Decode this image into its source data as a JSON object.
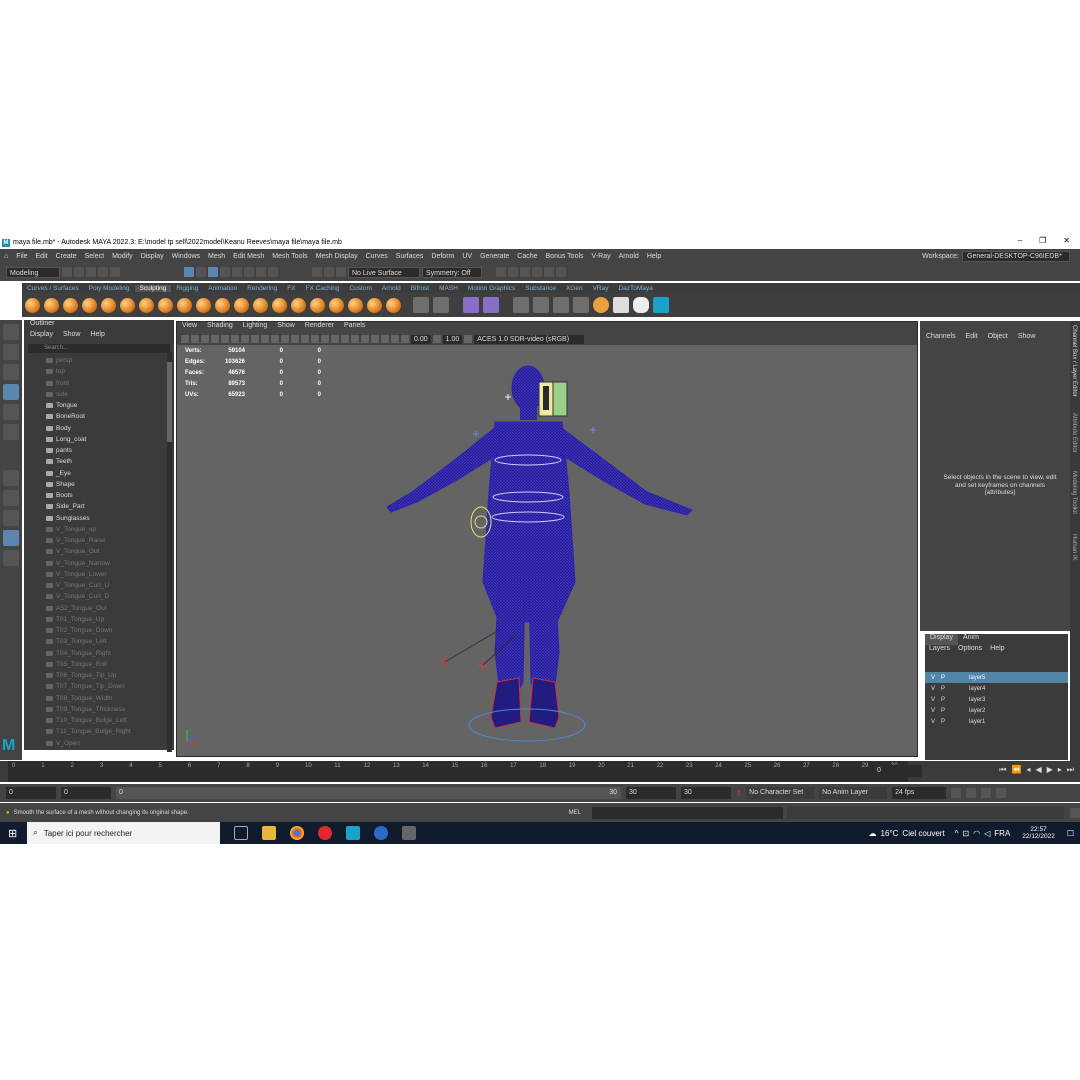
{
  "window": {
    "title": "maya file.mb* - Autodesk MAYA 2022.3: E:\\model tp sell\\2022model\\Keanu Reeves\\maya file\\maya file.mb"
  },
  "menubar": {
    "items": [
      "File",
      "Edit",
      "Create",
      "Select",
      "Modify",
      "Display",
      "Windows",
      "Mesh",
      "Edit Mesh",
      "Mesh Tools",
      "Mesh Display",
      "Curves",
      "Surfaces",
      "Deform",
      "UV",
      "Generate",
      "Cache",
      "Bonus Tools",
      "V-Ray",
      "Arnold",
      "Help"
    ],
    "workspace_label": "Workspace:",
    "workspace_value": "General-DESKTOP-C96IEDB*"
  },
  "statusline": {
    "mode": "Modeling",
    "live_surface": "No Live Surface",
    "symmetry": "Symmetry: Off"
  },
  "shelf": {
    "tabs": [
      "Curves / Surfaces",
      "Poly Modeling",
      "Sculpting",
      "Rigging",
      "Animation",
      "Rendering",
      "FX",
      "FX Caching",
      "Custom",
      "Arnold",
      "Bifrost",
      "MASH",
      "Motion Graphics",
      "Substance",
      "XGen",
      "VRay",
      "DazToMaya"
    ],
    "active_tab": "Sculpting"
  },
  "outliner": {
    "title": "Outliner",
    "menu": [
      "Display",
      "Show",
      "Help"
    ],
    "search_placeholder": "Search...",
    "items": [
      {
        "label": "persp",
        "dim": true
      },
      {
        "label": "top",
        "dim": true
      },
      {
        "label": "front",
        "dim": true
      },
      {
        "label": "side",
        "dim": true
      },
      {
        "label": "Tongue",
        "dim": false
      },
      {
        "label": "BoneRoot",
        "dim": false
      },
      {
        "label": "Body",
        "dim": false
      },
      {
        "label": "Long_coat",
        "dim": false
      },
      {
        "label": "pants",
        "dim": false
      },
      {
        "label": "Teeth",
        "dim": false
      },
      {
        "label": "_Eye",
        "dim": false
      },
      {
        "label": "Shape",
        "dim": false
      },
      {
        "label": "Boots",
        "dim": false
      },
      {
        "label": "Side_Part",
        "dim": false
      },
      {
        "label": "Sunglasses",
        "dim": false
      },
      {
        "label": "V_Tongue_up",
        "dim": true
      },
      {
        "label": "V_Tongue_Raise",
        "dim": true
      },
      {
        "label": "V_Tongue_Out",
        "dim": true
      },
      {
        "label": "V_Tongue_Narrow",
        "dim": true
      },
      {
        "label": "V_Tongue_Lower",
        "dim": true
      },
      {
        "label": "V_Tongue_Curl_U",
        "dim": true
      },
      {
        "label": "V_Tongue_Curl_D",
        "dim": true
      },
      {
        "label": "A52_Tongue_Out",
        "dim": true
      },
      {
        "label": "T01_Tongue_Up",
        "dim": true
      },
      {
        "label": "T02_Tongue_Down",
        "dim": true
      },
      {
        "label": "T03_Tongue_Left",
        "dim": true
      },
      {
        "label": "T04_Tongue_Right",
        "dim": true
      },
      {
        "label": "T05_Tongue_Roll",
        "dim": true
      },
      {
        "label": "T06_Tongue_Tip_Up",
        "dim": true
      },
      {
        "label": "T07_Tongue_Tip_Down",
        "dim": true
      },
      {
        "label": "T08_Tongue_Width",
        "dim": true
      },
      {
        "label": "T09_Tongue_Thickness",
        "dim": true
      },
      {
        "label": "T10_Tongue_Bulge_Left",
        "dim": true
      },
      {
        "label": "T11_Tongue_Bulge_Right",
        "dim": true
      },
      {
        "label": "V_Open",
        "dim": true
      }
    ]
  },
  "viewport": {
    "menu": [
      "View",
      "Shading",
      "Lighting",
      "Show",
      "Renderer",
      "Panels"
    ],
    "exposure": "0.00",
    "gamma": "1.00",
    "colorspace": "ACES 1.0 SDR-video (sRGB)",
    "hud": [
      {
        "label": "Verts:",
        "value": "59104",
        "a": "0",
        "b": "0"
      },
      {
        "label": "Edges:",
        "value": "103626",
        "a": "0",
        "b": "0"
      },
      {
        "label": "Faces:",
        "value": "46576",
        "a": "0",
        "b": "0"
      },
      {
        "label": "Tris:",
        "value": "89573",
        "a": "0",
        "b": "0"
      },
      {
        "label": "UVs:",
        "value": "65923",
        "a": "0",
        "b": "0"
      }
    ]
  },
  "channelbox": {
    "menu": [
      "Channels",
      "Edit",
      "Object",
      "Show"
    ],
    "message": "Select objects in the scene to view, edit and set keyframes on channels (attributes)",
    "side_tabs": [
      "Channel Box / Layer Editor",
      "Attribute Editor",
      "Modeling Toolkit",
      "Human IK"
    ]
  },
  "layers": {
    "tabs": [
      "Display",
      "Anim"
    ],
    "menu": [
      "Layers",
      "Options",
      "Help"
    ],
    "rows": [
      {
        "v": "V",
        "p": "P",
        "name": "layer5"
      },
      {
        "v": "V",
        "p": "P",
        "name": "layer4"
      },
      {
        "v": "V",
        "p": "P",
        "name": "layer3"
      },
      {
        "v": "V",
        "p": "P",
        "name": "layer2"
      },
      {
        "v": "V",
        "p": "P",
        "name": "layer1"
      }
    ]
  },
  "timeline": {
    "ticks": [
      "0",
      "1",
      "2",
      "3",
      "4",
      "5",
      "6",
      "7",
      "8",
      "9",
      "10",
      "11",
      "12",
      "13",
      "14",
      "15",
      "16",
      "17",
      "18",
      "19",
      "20",
      "21",
      "22",
      "23",
      "24",
      "25",
      "26",
      "27",
      "28",
      "29",
      "30"
    ],
    "current_frame": "0"
  },
  "range": {
    "start": "0",
    "start2": "0",
    "slider_start": "0",
    "slider_end": "30",
    "end": "30",
    "end2": "30",
    "character_set": "No Character Set",
    "anim_layer": "No Anim Layer",
    "fps": "24 fps"
  },
  "helpline": {
    "text": "Smooth the surface of a mesh without changing its original shape.",
    "mel": "MEL"
  },
  "taskbar": {
    "search": "Taper ici pour rechercher",
    "temp": "16°C",
    "weather": "Ciel couvert",
    "lang": "FRA",
    "time": "22:57",
    "date": "22/12/2022"
  }
}
